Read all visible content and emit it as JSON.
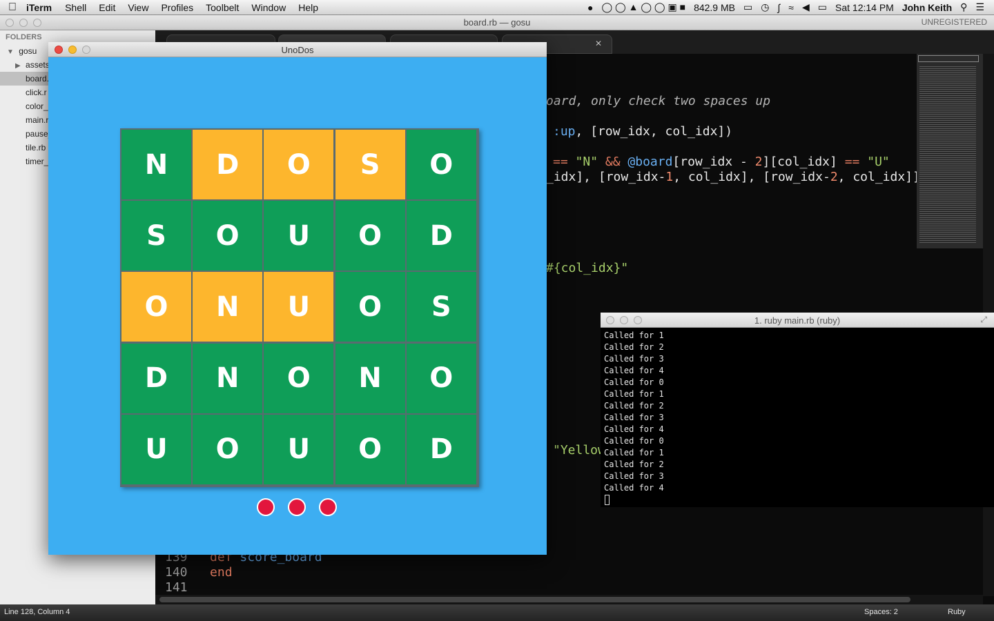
{
  "menubar": {
    "app_name": "iTerm",
    "items": [
      "Shell",
      "Edit",
      "View",
      "Profiles",
      "Toolbelt",
      "Window",
      "Help"
    ],
    "memory": "842.9 MB",
    "clock": "Sat 12:14 PM",
    "user": "John Keith"
  },
  "sublime": {
    "title": "board.rb — gosu",
    "unregistered": "UNREGISTERED",
    "sidebar": {
      "header": "FOLDERS",
      "root": "gosu",
      "items": [
        "assets",
        "board.",
        "click.r",
        "color_",
        "main.r",
        "pause_",
        "tile.rb",
        "timer_"
      ],
      "selected_index": 1
    },
    "code": {
      "comment_line": "oard, only check two spaces up",
      "line_sym": ":up",
      "line_call": ", [row_idx, col_idx])",
      "cond_a": "== ",
      "cond_str_n": "\"N\"",
      "cond_and": " && ",
      "cond_ivar": "@board",
      "cond_b": "[row_idx - ",
      "cond_num2": "2",
      "cond_c": "][col_idx] ",
      "cond_eq": "==",
      "cond_str_u": " \"U\"",
      "arr_a": "_idx], [row_idx-",
      "arr_num1": "1",
      "arr_b": ", col_idx], [row_idx-",
      "arr_num2": "2",
      "arr_c": ", col_idx]]",
      "interp": "#{col_idx}\"",
      "yellow_str": "\"Yellow",
      "lines": [
        {
          "num": "139",
          "kw": "def",
          "rest": "score_board"
        },
        {
          "num": "140",
          "kw": "end",
          "rest": ""
        },
        {
          "num": "141",
          "kw": "",
          "rest": ""
        }
      ]
    },
    "status_left": "Line 128, Column 4",
    "status_spaces": "Spaces: 2",
    "status_lang": "Ruby"
  },
  "game": {
    "title": "UnoDos",
    "colors": {
      "background": "#3daef2",
      "green_tile": "#0f9e58",
      "yellow_tile": "#fdb62d",
      "life": "#e2163d"
    },
    "board": [
      [
        {
          "l": "N",
          "c": "green"
        },
        {
          "l": "D",
          "c": "yellow"
        },
        {
          "l": "O",
          "c": "yellow"
        },
        {
          "l": "S",
          "c": "yellow"
        },
        {
          "l": "O",
          "c": "green"
        }
      ],
      [
        {
          "l": "S",
          "c": "green"
        },
        {
          "l": "O",
          "c": "green"
        },
        {
          "l": "U",
          "c": "green"
        },
        {
          "l": "O",
          "c": "green"
        },
        {
          "l": "D",
          "c": "green"
        }
      ],
      [
        {
          "l": "O",
          "c": "yellow"
        },
        {
          "l": "N",
          "c": "yellow"
        },
        {
          "l": "U",
          "c": "yellow"
        },
        {
          "l": "O",
          "c": "green"
        },
        {
          "l": "S",
          "c": "green"
        }
      ],
      [
        {
          "l": "D",
          "c": "green"
        },
        {
          "l": "N",
          "c": "green"
        },
        {
          "l": "O",
          "c": "green"
        },
        {
          "l": "N",
          "c": "green"
        },
        {
          "l": "O",
          "c": "green"
        }
      ],
      [
        {
          "l": "U",
          "c": "green"
        },
        {
          "l": "O",
          "c": "green"
        },
        {
          "l": "U",
          "c": "green"
        },
        {
          "l": "O",
          "c": "green"
        },
        {
          "l": "D",
          "c": "green"
        }
      ]
    ],
    "lives": 3
  },
  "terminal": {
    "title": "1. ruby main.rb (ruby)",
    "lines": [
      "Called for 1",
      "Called for 2",
      "Called for 3",
      "Called for 4",
      "Called for 0",
      "Called for 1",
      "Called for 2",
      "Called for 3",
      "Called for 4",
      "Called for 0",
      "Called for 1",
      "Called for 2",
      "Called for 3",
      "Called for 4"
    ]
  }
}
